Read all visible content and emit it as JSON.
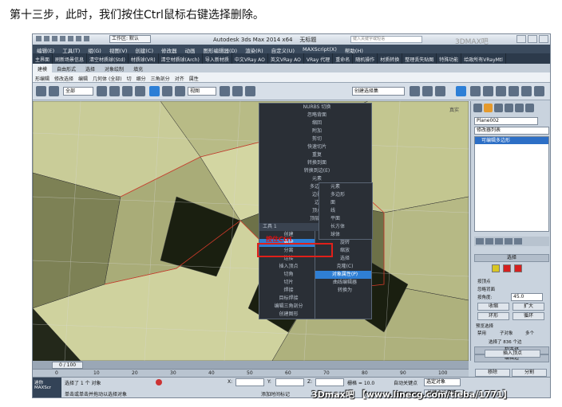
{
  "caption": "第十三步，此时，我们按住Ctrl鼠标右键选择删除。",
  "titlebar": {
    "workspace": "工作区: 默认",
    "title": "Autodesk 3ds Max 2014 x64",
    "filename": "无标题",
    "search_placeholder": "键入关键字或短语"
  },
  "menubar": [
    "编辑(E)",
    "工具(T)",
    "组(G)",
    "视图(V)",
    "创建(C)",
    "修改器",
    "动画",
    "图形编辑器(D)",
    "渲染(R)",
    "自定义(U)",
    "MAXScript(X)",
    "帮助(H)"
  ],
  "pluginbar": [
    "主界面",
    "刷新场景信息",
    "清空材质球(Std)",
    "材质球(VR)",
    "清空材质球(Arch)",
    "导入新材质",
    "中文VRay AO",
    "英文VRay AO",
    "VRay 代理",
    "重命名",
    "随机操作",
    "材质转换",
    "整理丢失贴图",
    "特殊功能",
    "给政所有VRayMtl"
  ],
  "ribbon_tabs": [
    "建模",
    "自由形式",
    "选择",
    "对象绘制",
    "填充"
  ],
  "ribbon_sub": [
    "形编辑",
    "修改选择",
    "编辑",
    "几何体 (全部)",
    "切",
    "细分",
    "三角剖分",
    "对齐",
    "属性"
  ],
  "toolbar": {
    "filter": "全部",
    "viewref": "视图",
    "selection_set": "创建选择集"
  },
  "viewport": {
    "label": "真实",
    "ctrl_hint": "按住Ctrl"
  },
  "quad_menu": {
    "top_items": [
      "NURBS 切换",
      "忽略背面",
      "缩回",
      "附加",
      "剪切",
      "快速切片",
      "重复",
      "转换到面",
      "转换到边(E)",
      "元素",
      "多边形",
      "边界",
      "边",
      "顶点",
      "顶层级"
    ],
    "sub_items": [
      "元素",
      "多边形",
      "面",
      "线",
      "平面",
      "长方体",
      "球体"
    ],
    "divider_left": "工具 1",
    "divider_right": "显示",
    "bottom_left": [
      "创建",
      "删除",
      "分离",
      "连接",
      "插入顶点",
      "切角",
      "切片",
      "焊接",
      "目标焊接",
      "编辑三角剖分",
      "创建图形"
    ],
    "bottom_right": [
      "移动",
      "旋转",
      "缩放",
      "选择",
      "克隆(C)",
      "对象属性(P)",
      "曲线编辑器",
      "转换为"
    ],
    "highlight_left": "删除",
    "highlight_right": "对象属性(P)"
  },
  "cmdpanel": {
    "object_name": "Plane002",
    "modifier_list": "修改器列表",
    "stack_item": "可编辑多边形",
    "rollout_select": "选择",
    "by_vertex": "按顶点",
    "ignore_back": "忽略背面",
    "by_angle": "按角度:",
    "angle_value": "45.0",
    "shrink": "收缩",
    "grow": "扩大",
    "ring": "环形",
    "loop": "循环",
    "preview_label": "预览选择",
    "preview_off": "禁用",
    "preview_sub": "子对象",
    "preview_multi": "多个",
    "selected_info": "选择了 836 个边",
    "rollout_soft": "软选择",
    "rollout_edit_edge": "编辑边",
    "insert_vertex": "插入顶点",
    "remove": "移除",
    "split": "分割"
  },
  "timeline": {
    "frame": "0 / 100",
    "ticks": [
      "0",
      "10",
      "20",
      "30",
      "40",
      "50",
      "60",
      "70",
      "80",
      "90",
      "100"
    ]
  },
  "statusbar": {
    "left_label": "迷你 MAXScr",
    "selected": "选择了 1 个 对象",
    "hint": "单击或单击并拖动以选择对象",
    "x_label": "X:",
    "y_label": "Y:",
    "z_label": "Z:",
    "grid": "栅格 = 10.0",
    "autokey": "自动关键点",
    "set_key": "设置关键点",
    "key_filter": "选定对象",
    "add_time_tag": "添加时间标记",
    "key_filters": "关键点过滤器..."
  },
  "watermark": "3Dmax吧 【www.linecg.com/tieba/1771】",
  "logo_watermark": "3DMAX吧",
  "colors": {
    "menu_bg": "#3b4b5e",
    "highlight": "#2f7fd4",
    "red_box": "#e0201a",
    "viewport_face": "#c9cc98"
  }
}
